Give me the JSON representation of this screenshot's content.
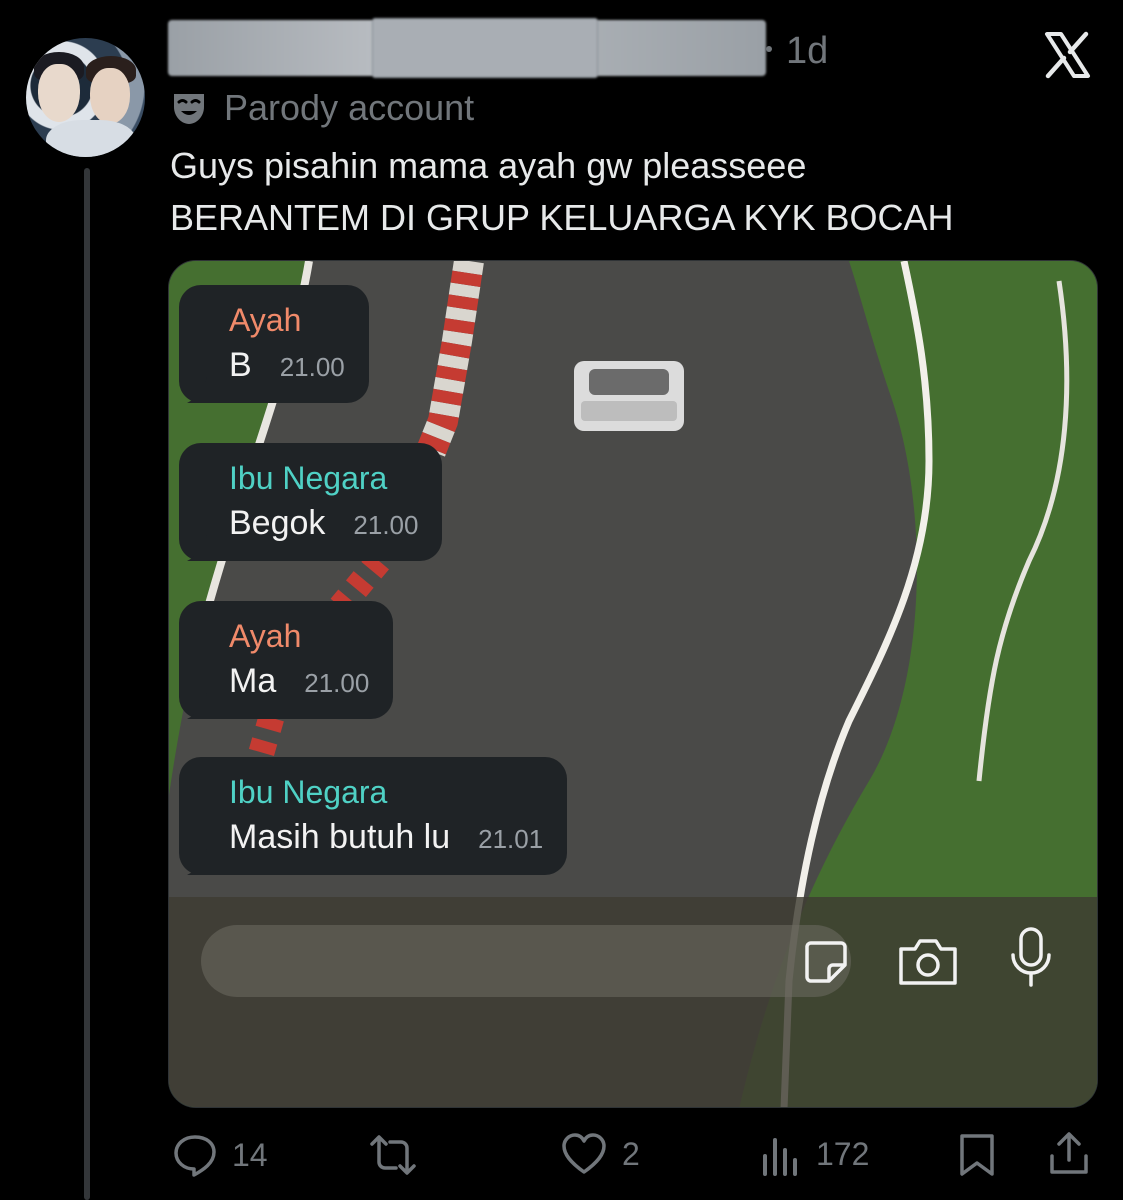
{
  "post": {
    "time": "1d",
    "label": "Parody account",
    "text_line1": "Guys pisahin mama ayah gw pleasseee",
    "text_line2": "BERANTEM DI GRUP KELUARGA KYK BOCAH"
  },
  "chat": {
    "messages": [
      {
        "sender": "Ayah",
        "text": "B",
        "time": "21.00",
        "sender_color": "#f08a6a"
      },
      {
        "sender": "Ibu Negara",
        "text": "Begok",
        "time": "21.00",
        "sender_color": "#4fd1c5"
      },
      {
        "sender": "Ayah",
        "text": "Ma",
        "time": "21.00",
        "sender_color": "#f08a6a"
      },
      {
        "sender": "Ibu Negara",
        "text": "Masih butuh lu",
        "time": "21.01",
        "sender_color": "#4fd1c5"
      }
    ],
    "icons": [
      "sticker-icon",
      "camera-icon",
      "microphone-icon"
    ]
  },
  "actions": {
    "replies": "14",
    "reposts": "",
    "likes": "2",
    "views": "172"
  },
  "icons": [
    "x-logo-icon",
    "parody-mask-icon",
    "reply-icon",
    "repost-icon",
    "like-icon",
    "views-icon",
    "bookmark-icon",
    "share-icon"
  ],
  "colors": {
    "background": "#000000",
    "text": "#e7e9ea",
    "muted": "#71767b"
  }
}
